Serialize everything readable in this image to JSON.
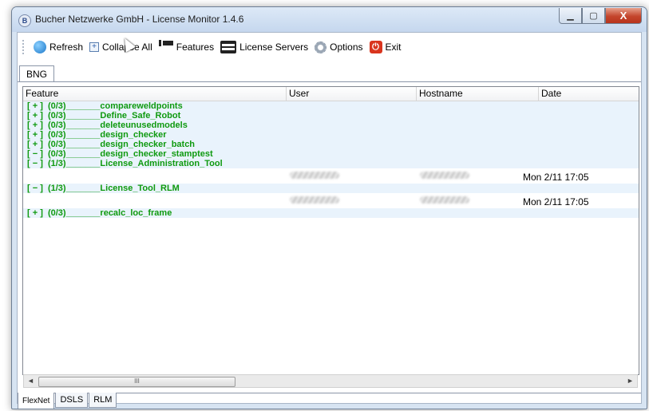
{
  "window": {
    "title": "Bucher Netzwerke GmbH - License Monitor 1.4.6",
    "app_icon_letter": "B",
    "controls": {
      "minimize": "▁",
      "maximize": "▢",
      "close": "X"
    }
  },
  "toolbar": {
    "refresh_label": "Refresh",
    "collapse_label": "Collapse All",
    "features_label": "Features",
    "license_servers_label": "License Servers",
    "options_label": "Options",
    "exit_label": "Exit",
    "icons": [
      "refresh-icon",
      "collapse-icon",
      "features-icon",
      "server-icon",
      "gear-icon",
      "power-icon"
    ]
  },
  "top_tab": "BNG",
  "columns": [
    "Feature",
    "User",
    "Hostname",
    "Date"
  ],
  "rows": [
    {
      "feature": "[ + ]  (0/3)_______compareweldpoints"
    },
    {
      "feature": "[ + ]  (0/3)_______Define_Safe_Robot"
    },
    {
      "feature": "[ + ]  (0/3)_______deleteunusedmodels"
    },
    {
      "feature": "[ + ]  (0/3)_______design_checker"
    },
    {
      "feature": "[ + ]  (0/3)_______design_checker_batch"
    },
    {
      "feature": "[ − ]  (0/3)_______design_checker_stamptest"
    },
    {
      "feature": "[ − ]  (1/3)_______License_Administration_Tool",
      "sub_date": "Mon 2/11 17:05"
    },
    {
      "feature": "[ − ]  (1/3)_______License_Tool_RLM",
      "sub_date": "Mon 2/11 17:05"
    },
    {
      "feature": "[ + ]  (0/3)_______recalc_loc_frame"
    }
  ],
  "scrollbar": {
    "left_arrow": "◄",
    "right_arrow": "►",
    "thumb_grip": "III"
  },
  "bottom_tabs": [
    "FlexNet",
    "DSLS",
    "RLM"
  ],
  "colors": {
    "feature_text": "#0f9a0f",
    "selected_row": "#e9f3fc",
    "window_frame": "#d7e4f2"
  }
}
